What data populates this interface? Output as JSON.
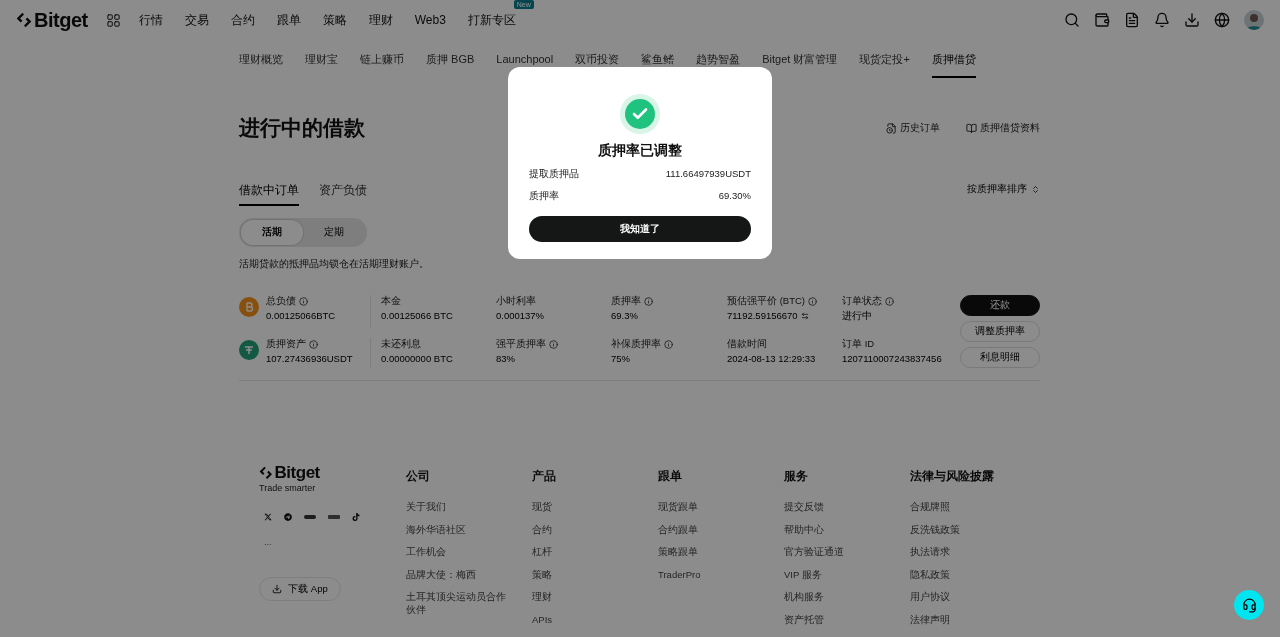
{
  "header": {
    "logo": "Bitget",
    "nav": [
      {
        "label": "行情"
      },
      {
        "label": "交易"
      },
      {
        "label": "合约"
      },
      {
        "label": "跟单"
      },
      {
        "label": "策略"
      },
      {
        "label": "理财"
      },
      {
        "label": "Web3"
      },
      {
        "label": "打新专区",
        "badge": "New"
      }
    ]
  },
  "subnav": [
    {
      "label": "理财概览",
      "selected": false
    },
    {
      "label": "理财宝",
      "selected": false
    },
    {
      "label": "链上赚币",
      "selected": false
    },
    {
      "label": "质押 BGB",
      "selected": false
    },
    {
      "label": "Launchpool",
      "selected": false
    },
    {
      "label": "双币投资",
      "selected": false
    },
    {
      "label": "鲨鱼鳍",
      "selected": false
    },
    {
      "label": "趋势智盈",
      "selected": false
    },
    {
      "label": "Bitget 财富管理",
      "selected": false
    },
    {
      "label": "现货定投+",
      "selected": false
    },
    {
      "label": "质押借贷",
      "selected": true
    }
  ],
  "page": {
    "title": "进行中的借款",
    "links": [
      {
        "label": "历史订单",
        "kind": "history"
      },
      {
        "label": "质押借贷资料",
        "kind": "docs"
      }
    ],
    "tabs": [
      {
        "label": "借款中订单",
        "selected": true
      },
      {
        "label": "资产负债",
        "selected": false
      }
    ],
    "sort": "按质押率排序",
    "segments": [
      {
        "label": "活期",
        "selected": true
      },
      {
        "label": "定期",
        "selected": false
      }
    ],
    "note": "活期贷款的抵押品均锁仓在活期理财账户。"
  },
  "loan": {
    "rows": [
      {
        "kind": "btc",
        "cells": [
          {
            "label": "总负债",
            "value": "0.00125066BTC",
            "info": true
          },
          {
            "label": "本金",
            "value": "0.00125066 BTC",
            "info": false
          },
          {
            "label": "小时利率",
            "value": "0.000137%",
            "info": false
          },
          {
            "label": "质押率",
            "value": "69.3%",
            "info": true
          },
          {
            "label": "预估强平价 (BTC)",
            "value": "71192.59156670",
            "info": true,
            "swap": true
          },
          {
            "label": "订单状态",
            "value": "进行中",
            "info": true
          }
        ]
      },
      {
        "kind": "usdt",
        "cells": [
          {
            "label": "质押资产",
            "value": "107.27436936USDT",
            "info": true
          },
          {
            "label": "未还利息",
            "value": "0.00000000 BTC",
            "info": false
          },
          {
            "label": "强平质押率",
            "value": "83%",
            "info": true
          },
          {
            "label": "补保质押率",
            "value": "75%",
            "info": true
          },
          {
            "label": "借款时间",
            "value": "2024-08-13 12:29:33",
            "info": false
          },
          {
            "label": "订单 ID",
            "value": "1207110007243837456",
            "info": false
          }
        ]
      }
    ],
    "actions": [
      {
        "label": "还款",
        "kind": "primary"
      },
      {
        "label": "调整质押率",
        "kind": "outline"
      },
      {
        "label": "利息明细",
        "kind": "outline"
      }
    ]
  },
  "footer": {
    "logo": "Bitget",
    "tagline": "Trade smarter",
    "more": "...",
    "download": "下载 App",
    "columns": [
      {
        "heading": "公司",
        "links": [
          "关于我们",
          "海外华语社区",
          "工作机会",
          "品牌大使：梅西",
          "土耳其顶尖运动员合作伙伴"
        ]
      },
      {
        "heading": "产品",
        "links": [
          "现货",
          "合约",
          "杠杆",
          "策略",
          "理财",
          "APIs"
        ]
      },
      {
        "heading": "跟单",
        "links": [
          "现货跟单",
          "合约跟单",
          "策略跟单",
          "TraderPro"
        ]
      },
      {
        "heading": "服务",
        "links": [
          "提交反馈",
          "帮助中心",
          "官方验证通道",
          "VIP 服务",
          "机构服务",
          "资产托管"
        ]
      },
      {
        "heading": "法律与风险披露",
        "links": [
          "合规牌照",
          "反洗钱政策",
          "执法请求",
          "隐私政策",
          "用户协议",
          "法律声明"
        ]
      }
    ]
  },
  "modal": {
    "title": "质押率已调整",
    "rows": [
      {
        "label": "提取质押品",
        "value": "111.66497939USDT"
      },
      {
        "label": "质押率",
        "value": "69.30%"
      }
    ],
    "button": "我知道了"
  }
}
